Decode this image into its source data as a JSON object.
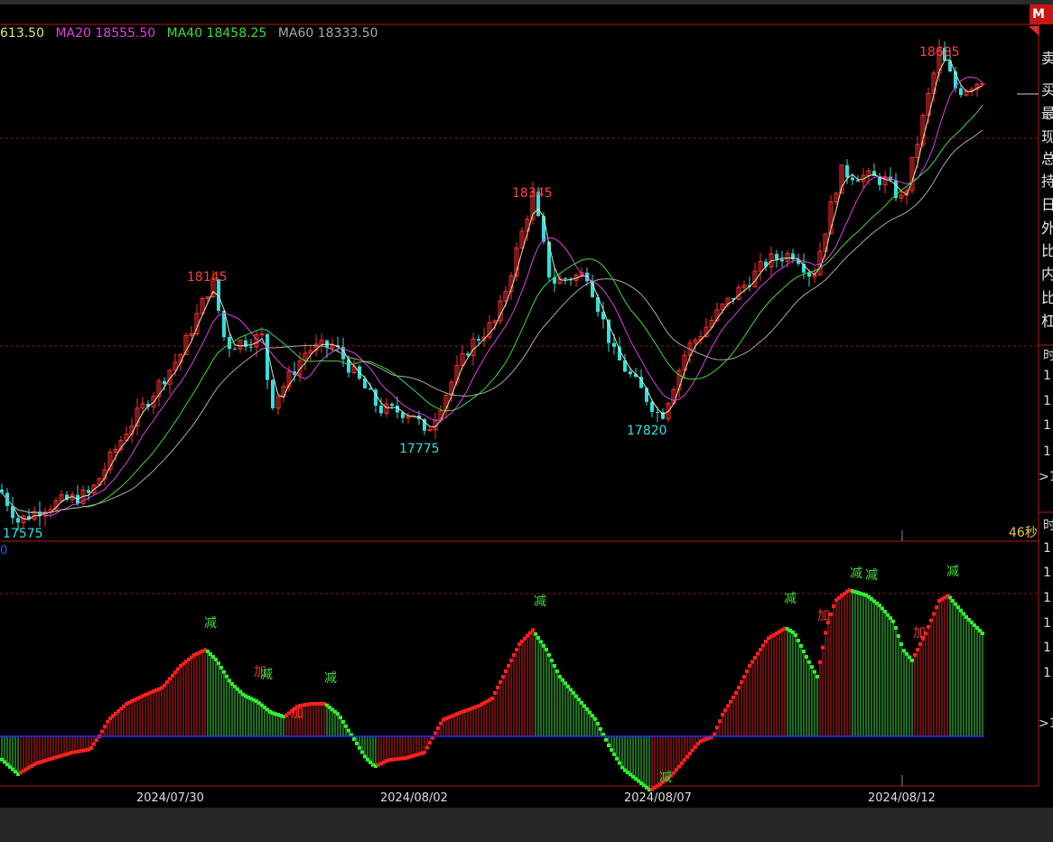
{
  "chart_data": [
    {
      "type": "candlestick",
      "title": "",
      "ma_legend": [
        {
          "name": "",
          "label": "613.50",
          "color": "#e6e66a"
        },
        {
          "name": "MA20",
          "label": "MA20 18555.50",
          "color": "#e040e0"
        },
        {
          "name": "MA40",
          "label": "MA40 18458.25",
          "color": "#3cdc3c"
        },
        {
          "name": "MA60",
          "label": "MA60 18333.50",
          "color": "#a8a8a8"
        }
      ],
      "annotations": [
        {
          "text": "17575",
          "color": "#30e0e0"
        },
        {
          "text": "18145",
          "color": "#ff4040"
        },
        {
          "text": "17775",
          "color": "#30e0e0"
        },
        {
          "text": "18345",
          "color": "#ff4040"
        },
        {
          "text": "17820",
          "color": "#30e0e0"
        },
        {
          "text": "18685",
          "color": "#ff4040"
        }
      ],
      "x_dates": [
        "2024/07/30",
        "2024/08/02",
        "2024/08/07",
        "2024/08/12"
      ],
      "y_range": [
        17525,
        18760
      ],
      "timer": "46秒",
      "zero_label": "0",
      "up_color": "#ff3030",
      "down_color": "#30e0e0"
    },
    {
      "type": "bar",
      "signals": [
        {
          "text": "减",
          "color": "#3cdc3c"
        },
        {
          "text": "加",
          "color": "#ff3030"
        },
        {
          "text": "减",
          "color": "#3cdc3c"
        },
        {
          "text": "加",
          "color": "#ff3030"
        },
        {
          "text": "减",
          "color": "#3cdc3c"
        },
        {
          "text": "减",
          "color": "#3cdc3c"
        },
        {
          "text": "减",
          "color": "#3cdc3c"
        },
        {
          "text": "减",
          "color": "#3cdc3c"
        },
        {
          "text": "加",
          "color": "#ff3030"
        },
        {
          "text": "减",
          "color": "#3cdc3c"
        },
        {
          "text": "减",
          "color": "#3cdc3c"
        },
        {
          "text": "加",
          "color": "#ff3030"
        },
        {
          "text": "减",
          "color": "#3cdc3c"
        }
      ],
      "histogram_points": [
        [
          0,
          -20
        ],
        [
          20,
          -35
        ],
        [
          40,
          -25
        ],
        [
          60,
          -20
        ],
        [
          80,
          -15
        ],
        [
          100,
          -12
        ],
        [
          110,
          0
        ],
        [
          120,
          15
        ],
        [
          140,
          30
        ],
        [
          160,
          38
        ],
        [
          180,
          45
        ],
        [
          200,
          65
        ],
        [
          215,
          75
        ],
        [
          228,
          80
        ],
        [
          240,
          70
        ],
        [
          255,
          50
        ],
        [
          270,
          38
        ],
        [
          285,
          32
        ],
        [
          300,
          22
        ],
        [
          315,
          18
        ],
        [
          330,
          28
        ],
        [
          345,
          30
        ],
        [
          360,
          30
        ],
        [
          375,
          20
        ],
        [
          390,
          0
        ],
        [
          405,
          -20
        ],
        [
          415,
          -28
        ],
        [
          430,
          -22
        ],
        [
          450,
          -20
        ],
        [
          470,
          -15
        ],
        [
          490,
          15
        ],
        [
          510,
          22
        ],
        [
          530,
          28
        ],
        [
          545,
          35
        ],
        [
          560,
          60
        ],
        [
          575,
          85
        ],
        [
          590,
          98
        ],
        [
          605,
          80
        ],
        [
          620,
          55
        ],
        [
          640,
          35
        ],
        [
          660,
          15
        ],
        [
          675,
          -10
        ],
        [
          690,
          -30
        ],
        [
          705,
          -40
        ],
        [
          720,
          -50
        ],
        [
          730,
          -45
        ],
        [
          745,
          -35
        ],
        [
          760,
          -20
        ],
        [
          775,
          -5
        ],
        [
          790,
          0
        ],
        [
          800,
          20
        ],
        [
          815,
          40
        ],
        [
          830,
          65
        ],
        [
          850,
          90
        ],
        [
          870,
          100
        ],
        [
          880,
          95
        ],
        [
          895,
          70
        ],
        [
          905,
          55
        ],
        [
          915,
          100
        ],
        [
          925,
          125
        ],
        [
          940,
          135
        ],
        [
          960,
          130
        ],
        [
          975,
          120
        ],
        [
          990,
          105
        ],
        [
          1000,
          80
        ],
        [
          1010,
          70
        ],
        [
          1025,
          95
        ],
        [
          1040,
          125
        ],
        [
          1050,
          130
        ],
        [
          1070,
          110
        ],
        [
          1088,
          95
        ]
      ]
    }
  ],
  "sidebar": {
    "chars": [
      "卖",
      "买",
      "最",
      "现",
      "总",
      "持",
      "日",
      "外",
      "比",
      "内",
      "比",
      "杠"
    ],
    "ticks_top": [
      "时",
      "1",
      "1",
      "1",
      "1",
      ">1"
    ],
    "ticks_bottom": [
      "时",
      "1",
      "1",
      "1",
      "1",
      "1",
      "1",
      ">1"
    ],
    "badge": "M"
  }
}
